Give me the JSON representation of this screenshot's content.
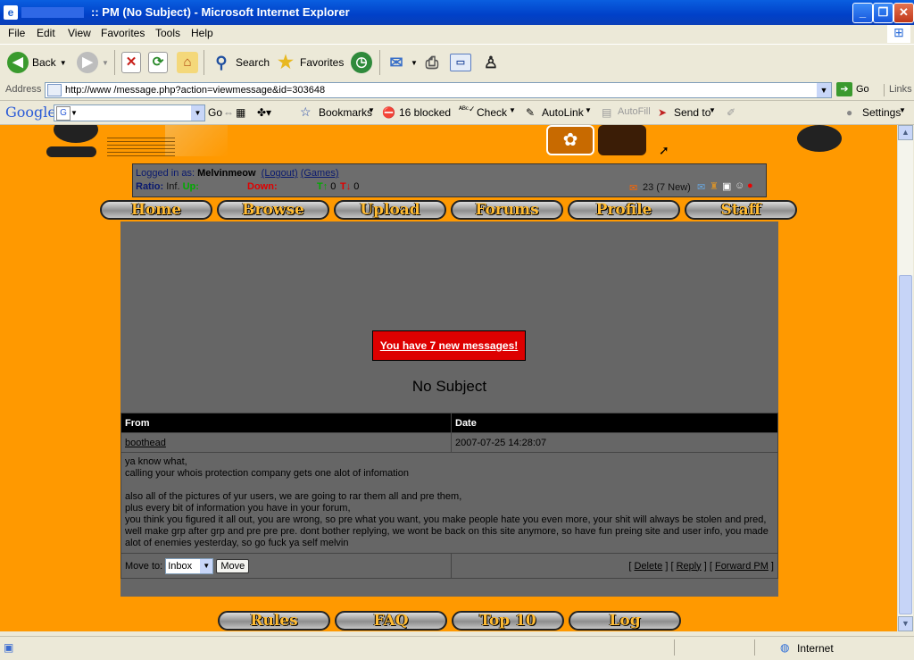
{
  "window": {
    "title": ":: PM (No Subject) - Microsoft Internet Explorer"
  },
  "menu": [
    "File",
    "Edit",
    "View",
    "Favorites",
    "Tools",
    "Help"
  ],
  "toolbar": {
    "back": "Back",
    "search": "Search",
    "favorites": "Favorites"
  },
  "address": {
    "label": "Address",
    "url": "http://www                /message.php?action=viewmessage&id=303648",
    "go": "Go",
    "links": "Links"
  },
  "googlebar": {
    "logo": "Google",
    "go": "Go",
    "bookmarks": "Bookmarks",
    "blocked": "16 blocked",
    "check": "Check",
    "autolink": "AutoLink",
    "autofill": "AutoFill",
    "sendto": "Send to",
    "settings": "Settings"
  },
  "login": {
    "prefix": "Logged in as:",
    "user": "Melvinmeow",
    "logout": "(Logout)",
    "games": "(Games)",
    "ratio_label": "Ratio:",
    "ratio_value": "Inf.",
    "up": "Up:",
    "down": "Down:",
    "t_up": "0",
    "t_down": "0",
    "mail": "23 (7 New)"
  },
  "nav": [
    "Home",
    "Browse",
    "Upload",
    "Forums",
    "Profile",
    "Staff"
  ],
  "notice": "You have 7 new messages!",
  "message": {
    "subject": "No Subject",
    "from_header": "From",
    "date_header": "Date",
    "from": "boothead",
    "date": "2007-07-25 14:28:07",
    "body": [
      "ya know what,",
      "calling your whois protection company gets one alot of infomation",
      "",
      "also all of the pictures of yur users, we are going to rar them all and pre them,",
      "plus every bit of information you have in your forum,",
      "you think you figured it all out, you are wrong, so pre what you want, you make people hate you even more, your shit will always be stolen and pred,",
      "well make grp after grp and pre pre pre. dont bother replying, we wont be back on this site anymore, so have fun preing site and user info, you made",
      "alot of enemies yesterday, so go fuck ya self melvin"
    ],
    "move_label": "Move to:",
    "folder": "Inbox",
    "move_button": "Move",
    "delete": "Delete",
    "reply": "Reply",
    "forward": "Forward PM"
  },
  "footer_nav": [
    "Rules",
    "FAQ",
    "Top 10",
    "Log"
  ],
  "status": {
    "zone": "Internet"
  }
}
